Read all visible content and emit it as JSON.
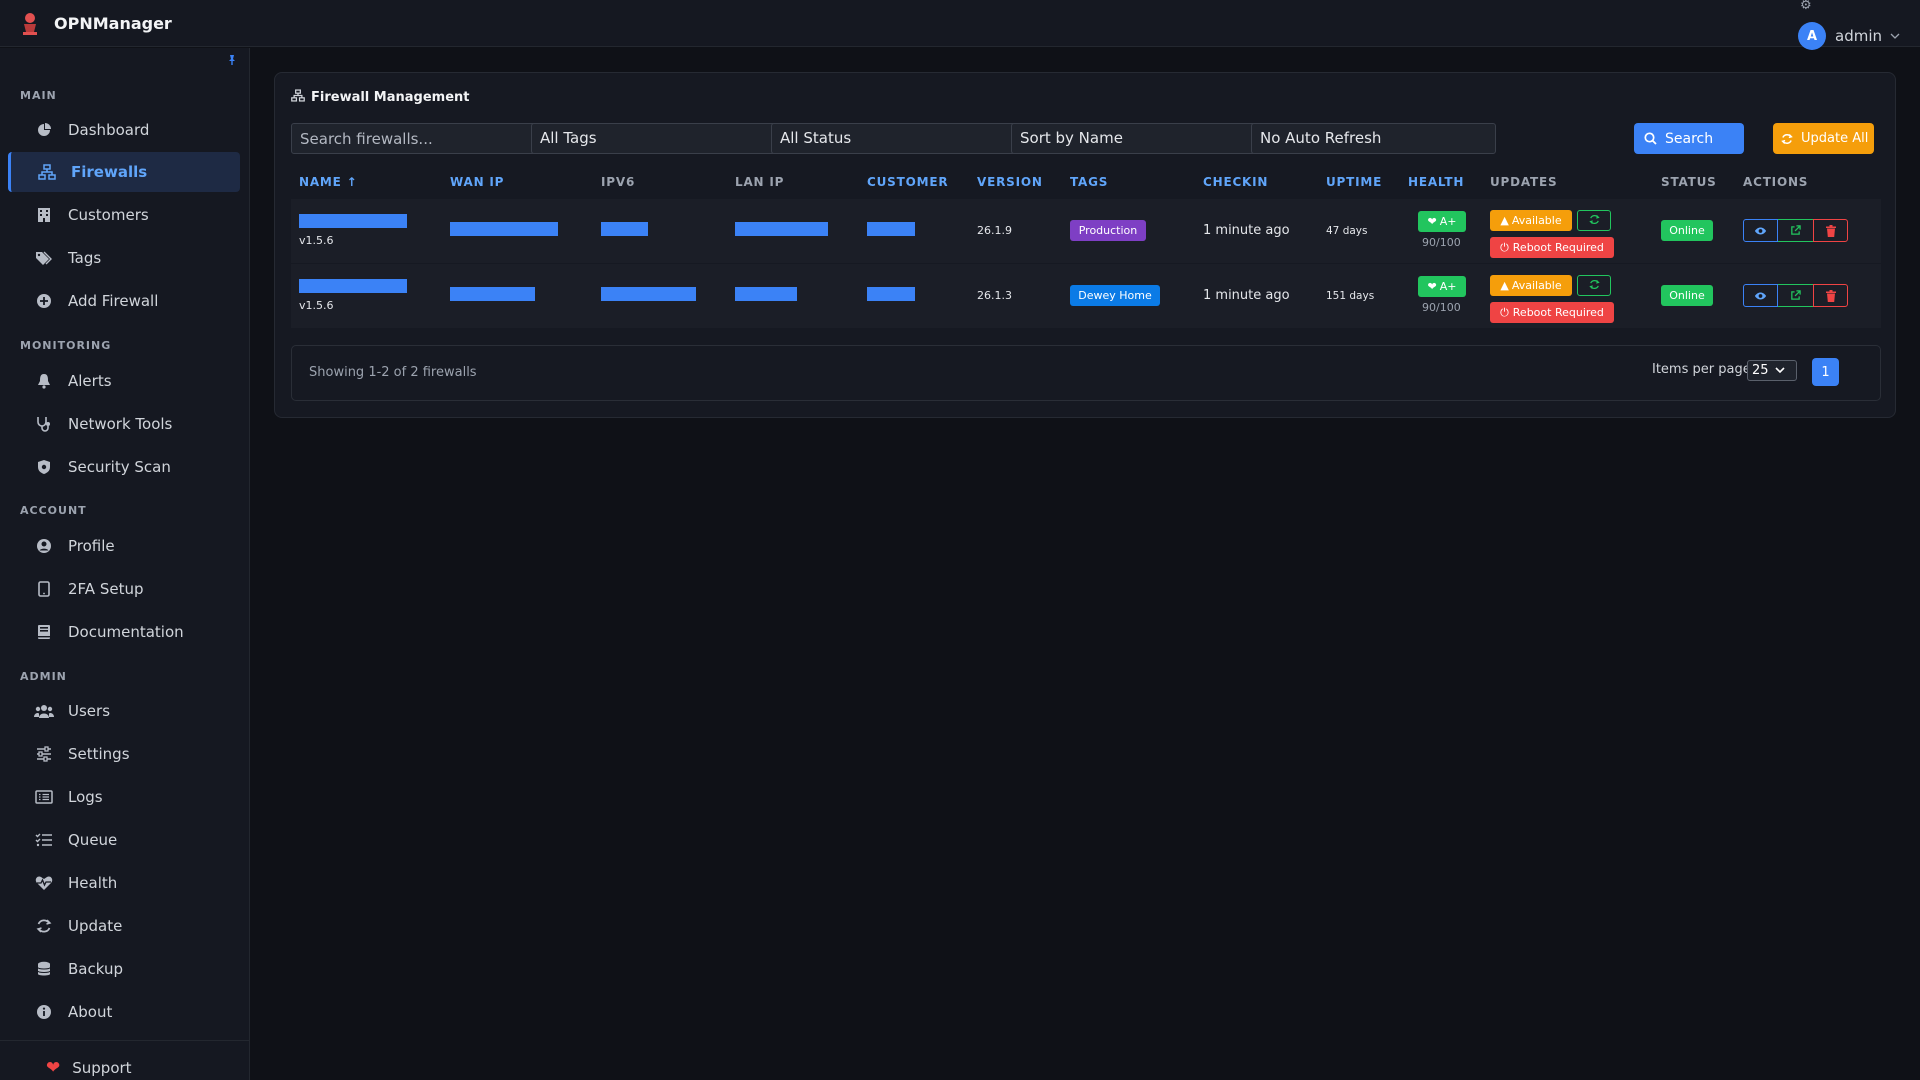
{
  "app": {
    "title": "OPNManager"
  },
  "user": {
    "initial": "A",
    "name": "admin"
  },
  "sidebar": {
    "sections": [
      {
        "label": "MAIN"
      },
      {
        "label": "MONITORING"
      },
      {
        "label": "ACCOUNT"
      },
      {
        "label": "ADMIN"
      }
    ],
    "items": [
      {
        "label": "Dashboard",
        "icon": "dashboard-icon"
      },
      {
        "label": "Firewalls",
        "icon": "network-icon",
        "active": true
      },
      {
        "label": "Customers",
        "icon": "building-icon"
      },
      {
        "label": "Tags",
        "icon": "tags-icon"
      },
      {
        "label": "Add Firewall",
        "icon": "plus-circle-icon"
      },
      {
        "label": "Alerts",
        "icon": "bell-icon"
      },
      {
        "label": "Network Tools",
        "icon": "stethoscope-icon"
      },
      {
        "label": "Security Scan",
        "icon": "shield-icon"
      },
      {
        "label": "Profile",
        "icon": "user-circle-icon"
      },
      {
        "label": "2FA Setup",
        "icon": "phone-icon"
      },
      {
        "label": "Documentation",
        "icon": "book-icon"
      },
      {
        "label": "Users",
        "icon": "users-icon"
      },
      {
        "label": "Settings",
        "icon": "sliders-icon"
      },
      {
        "label": "Logs",
        "icon": "list-icon"
      },
      {
        "label": "Queue",
        "icon": "tasks-icon"
      },
      {
        "label": "Health",
        "icon": "heartbeat-icon"
      },
      {
        "label": "Update",
        "icon": "sync-icon"
      },
      {
        "label": "Backup",
        "icon": "database-icon"
      },
      {
        "label": "About",
        "icon": "info-icon"
      }
    ],
    "support": "Support"
  },
  "main": {
    "title": "Firewall Management",
    "filters": {
      "search_placeholder": "Search firewalls...",
      "tags": "All Tags",
      "status": "All Status",
      "sort": "Sort by Name",
      "refresh": "No Auto Refresh"
    },
    "search_button": "Search",
    "update_all_button": "Update All",
    "columns": [
      "NAME ↑",
      "WAN IP",
      "IPV6",
      "LAN IP",
      "CUSTOMER",
      "VERSION",
      "TAGS",
      "CHECKIN",
      "UPTIME",
      "HEALTH",
      "UPDATES",
      "STATUS",
      "ACTIONS"
    ],
    "rows": [
      {
        "agent_version": "v1.5.6",
        "version": "26.1.9",
        "tag": "Production",
        "tag_color": "#7e3fc4",
        "checkin": "1 minute ago",
        "uptime": "47 days",
        "health_grade": "A+",
        "health_score": "90/100",
        "update_label": "Available",
        "reboot_label": "Reboot Required",
        "status": "Online"
      },
      {
        "agent_version": "v1.5.6",
        "version": "26.1.3",
        "tag": "Dewey Home",
        "tag_color": "#0b7be6",
        "checkin": "1 minute ago",
        "uptime": "151 days",
        "health_grade": "A+",
        "health_score": "90/100",
        "update_label": "Available",
        "reboot_label": "Reboot Required",
        "status": "Online"
      }
    ],
    "footer": {
      "showing": "Showing 1-2 of 2 firewalls",
      "items_per_page_label": "Items per page:",
      "items_per_page": "25",
      "page": "1"
    }
  }
}
